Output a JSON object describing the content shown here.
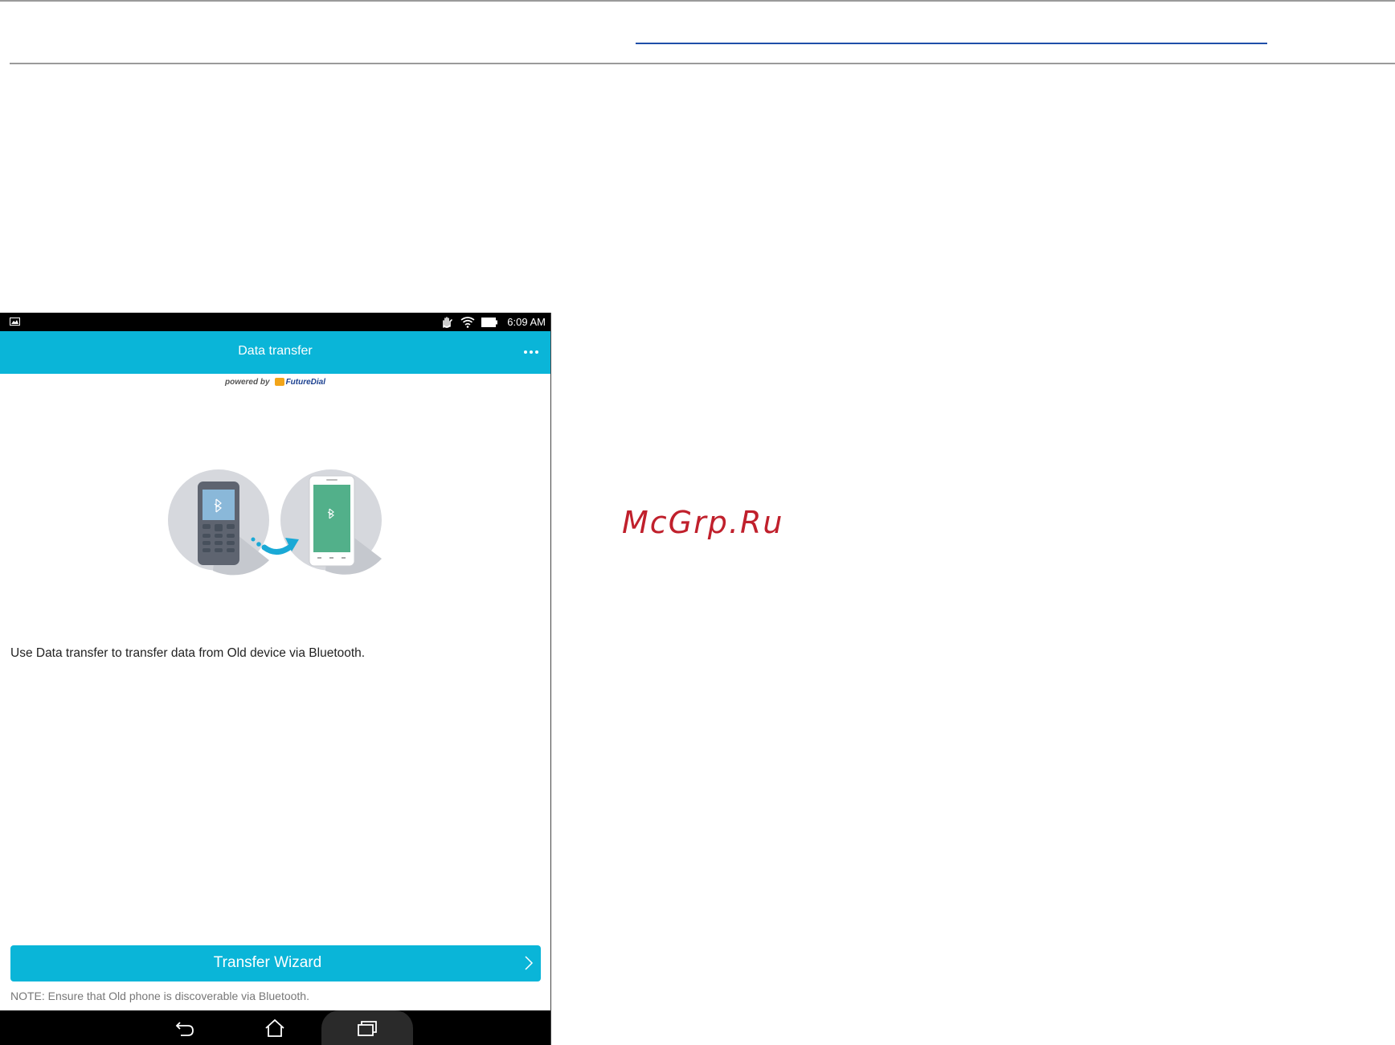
{
  "watermark": "McGrp.Ru",
  "device": {
    "status_bar": {
      "time": "6:09 AM",
      "icons": [
        "image-notification-icon",
        "hand-gesture-icon",
        "wifi-icon",
        "battery-icon"
      ]
    },
    "app_bar": {
      "title": "Data transfer",
      "overflow_icon": "more-horizontal-icon"
    },
    "powered_by": {
      "prefix": "powered by",
      "brand": "FutureDial"
    },
    "illustration": {
      "icons": [
        "old-phone-icon",
        "bluetooth-icon",
        "transfer-arrow-icon",
        "new-phone-icon"
      ]
    },
    "description": "Use Data transfer to transfer data from Old device via Bluetooth.",
    "wizard_button": {
      "label": "Transfer Wizard",
      "icon": "chevron-right-icon"
    },
    "note": "NOTE: Ensure that Old phone is discoverable via Bluetooth.",
    "nav_bar": {
      "buttons": [
        "back-icon",
        "home-icon",
        "recent-apps-icon"
      ]
    },
    "colors": {
      "accent": "#0ab5d8",
      "watermark": "#c0202c",
      "rule_blue": "#1f4fa8"
    }
  }
}
